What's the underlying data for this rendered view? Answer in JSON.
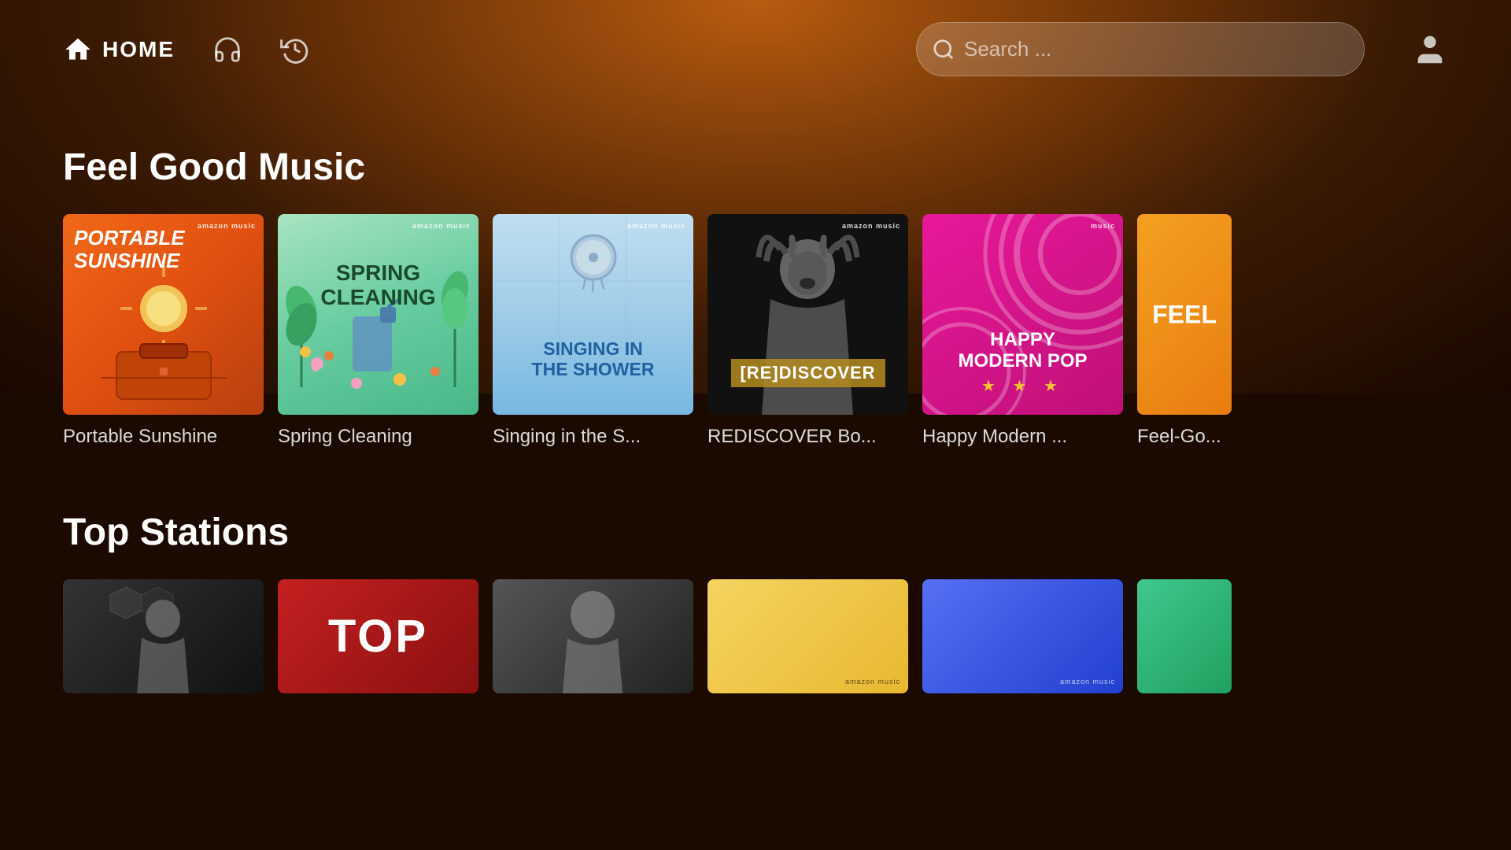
{
  "header": {
    "home_label": "HOME",
    "search_placeholder": "Search ...",
    "search_label": "Search"
  },
  "sections": [
    {
      "id": "feel-good",
      "title": "Feel Good Music",
      "cards": [
        {
          "id": "portable-sunshine",
          "title": "Portable Sunshine",
          "display_title": "Portable Sunshine",
          "badge": "amazon music",
          "card_text": "PORTABLE SUNSHINE",
          "bg_type": "orange-gradient"
        },
        {
          "id": "spring-cleaning",
          "title": "Spring Cleaning",
          "display_title": "Spring Cleaning",
          "badge": "amazon music",
          "card_text": "SPRING CLEANING",
          "bg_type": "green-gradient"
        },
        {
          "id": "singing-shower",
          "title": "Singing in the S...",
          "display_title": "Singing in the S...",
          "badge": "amazon music",
          "card_text": "SINGING IN THE SHOWER",
          "bg_type": "blue-gradient"
        },
        {
          "id": "rediscover",
          "title": "REDISCOVER Bo...",
          "display_title": "REDISCOVER Bo...",
          "badge": "amazon music",
          "card_text": "[RE]DISCOVER",
          "bg_type": "dark"
        },
        {
          "id": "happy-modern-pop",
          "title": "Happy Modern ...",
          "display_title": "Happy Modern ...",
          "badge": "music",
          "card_text": "HAPPY MODERN POP",
          "stars": "★ ★ ★",
          "bg_type": "pink-gradient"
        },
        {
          "id": "feel-good-country",
          "title": "Feel-Go...",
          "display_title": "Feel-Go...",
          "badge": "",
          "card_text": "FEEL",
          "bg_type": "orange2-gradient"
        }
      ]
    },
    {
      "id": "top-stations",
      "title": "Top Stations",
      "cards": [
        {
          "id": "station-1",
          "bg_type": "dark-portrait"
        },
        {
          "id": "station-2",
          "text": "TOP",
          "bg_type": "red"
        },
        {
          "id": "station-3",
          "bg_type": "dark-portrait2"
        },
        {
          "id": "station-4",
          "bg_type": "yellow-amz"
        },
        {
          "id": "station-5",
          "bg_type": "blue-amz"
        },
        {
          "id": "station-6",
          "bg_type": "green-partial"
        }
      ]
    }
  ]
}
